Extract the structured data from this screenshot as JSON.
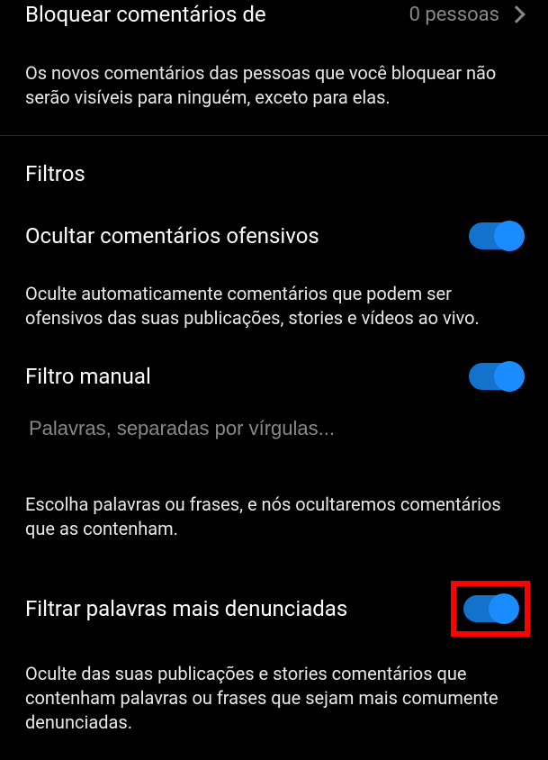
{
  "block": {
    "title": "Bloquear comentários de",
    "value": "0 pessoas",
    "description": "Os novos comentários das pessoas que você bloquear não serão visíveis para ninguém, exceto para elas."
  },
  "filters": {
    "heading": "Filtros",
    "offensive": {
      "label": "Ocultar comentários ofensivos",
      "description": "Oculte automaticamente comentários que podem ser ofensivos das suas publicações, stories e vídeos ao vivo."
    },
    "manual": {
      "label": "Filtro manual",
      "placeholder": "Palavras, separadas por vírgulas...",
      "description": "Escolha palavras ou frases, e nós ocultaremos comentários que as contenham."
    },
    "reported": {
      "label": "Filtrar palavras mais denunciadas",
      "description": "Oculte das suas publicações e stories comentários que contenham palavras ou frases que sejam mais comumente denunciadas."
    }
  }
}
